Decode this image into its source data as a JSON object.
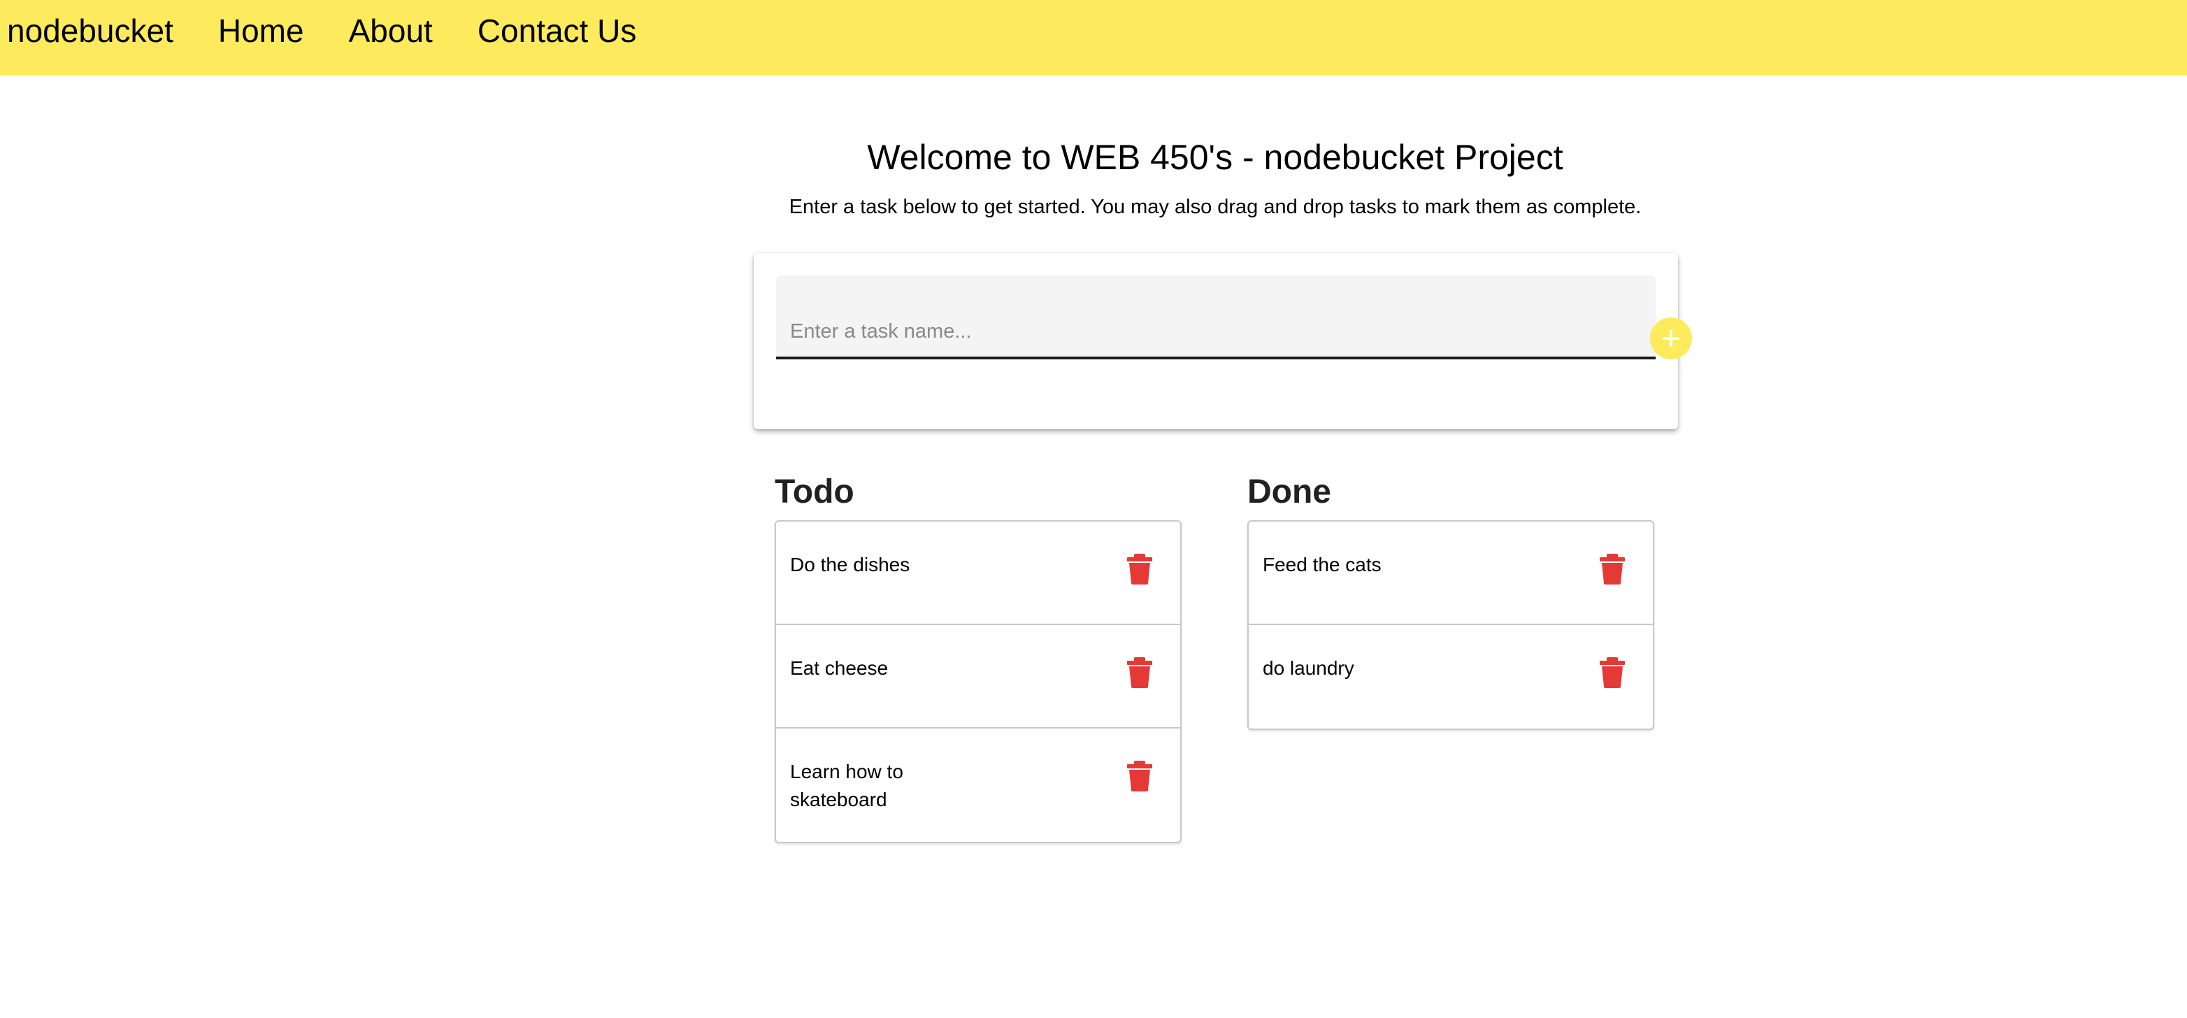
{
  "toolbar": {
    "brand": "nodebucket",
    "nav": [
      "Home",
      "About",
      "Contact Us"
    ]
  },
  "header": {
    "title": "Welcome to WEB 450's - nodebucket Project",
    "subtitle": "Enter a task below to get started. You may also drag and drop tasks to mark them as complete."
  },
  "task_form": {
    "placeholder": "Enter a task name...",
    "value": "",
    "add_icon": "plus-circle-icon"
  },
  "todo": {
    "title": "Todo",
    "items": [
      "Do the dishes",
      "Eat cheese",
      "Learn how to skateboard"
    ]
  },
  "done": {
    "title": "Done",
    "items": [
      "Feed the cats",
      "do laundry"
    ]
  },
  "colors": {
    "accent": "#fdea5d",
    "delete": "#e53935"
  },
  "icons": {
    "delete": "trash-icon"
  }
}
